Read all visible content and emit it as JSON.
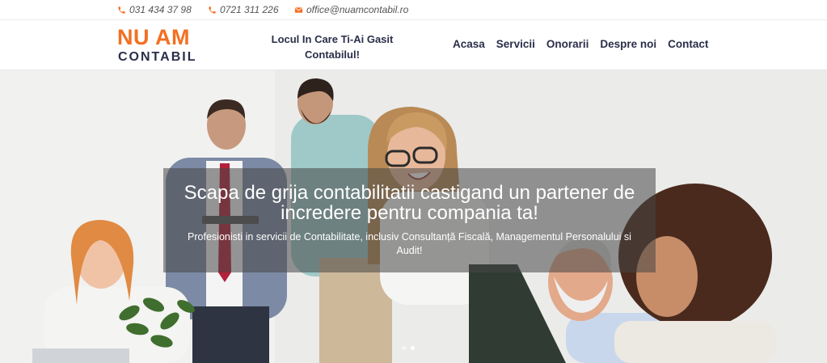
{
  "topbar": {
    "phone1": "031 434 37 98",
    "phone2": "0721 311 226",
    "email": "office@nuamcontabil.ro",
    "icon_color": "#f36f21"
  },
  "header": {
    "logo_line1": "NU AM",
    "logo_line2": "CONTABIL",
    "tagline": "Locul In Care Ti-Ai Gasit Contabilul!",
    "nav": [
      "Acasa",
      "Servicii",
      "Onorarii",
      "Despre noi",
      "Contact"
    ]
  },
  "hero": {
    "heading": "Scapa de grija contabilitatii castigand un partener de incredere pentru compania ta!",
    "subheading": "Profesionisti in servicii de Contabilitate, inclusiv Consultanță Fiscală, Managementul Personalului si Audit!",
    "slides": 2,
    "active_slide": 1
  },
  "colors": {
    "brand_orange": "#f36f21",
    "brand_navy": "#2b2e4a"
  }
}
